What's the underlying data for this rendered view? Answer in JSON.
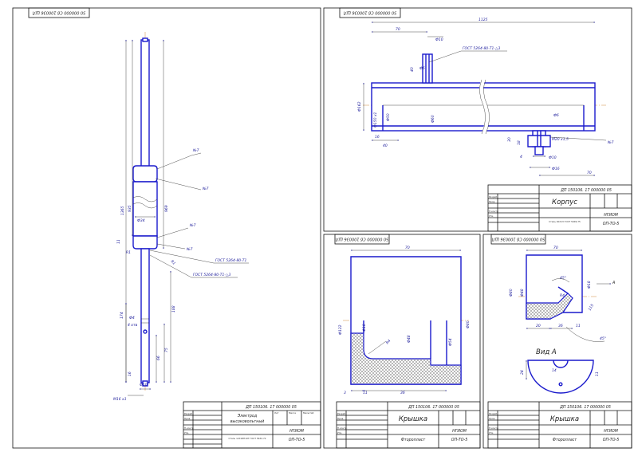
{
  "stamps": {
    "electrode": "50 000000 Сб 100036 ШЛ",
    "housing": "50 000000 Сб 100036 ШЛ",
    "lid": "50 000000 Сб 100036 ШЛ",
    "cap": "50 000000 Сб 100036 ШЛ"
  },
  "electrode": {
    "dims": {
      "total": "1365",
      "upper": "935",
      "mid": "969",
      "d34": "Ф34",
      "d10": "Ф10",
      "d4": "Ф4",
      "d4b": "4 отв",
      "m16": "М16 х1",
      "l11": "11",
      "l174": "174",
      "l188": "188",
      "l75": "75",
      "l66": "66",
      "l16": "16",
      "r1": "R1",
      "r1b": "R1",
      "r1c": "R1"
    },
    "callouts": [
      "№7",
      "№7",
      "№7",
      "№7",
      "№7"
    ],
    "gost1": "ГОСТ 5264-80-Т1",
    "gost2": "ГОСТ 5264-80-Т1-△3",
    "title": {
      "doc": "ДП 150106. 17 000000 05",
      "name1": "Электрод",
      "name2": "высоковольтный",
      "material": "Сталь 12Х18Н10Т ГОСТ 5632-72",
      "org1": "НГИОМ",
      "org2": "ОП-ТО-5"
    }
  },
  "housing": {
    "dims": {
      "w": "1125",
      "l70": "70",
      "d10": "Ф10",
      "d6": "Ф6",
      "l40": "40",
      "d162": "Ф162",
      "d50": "Ф50",
      "d60": "Ф60",
      "d150": "Ф150 х1",
      "l16": "16",
      "l40b": "40",
      "l30": "30",
      "l18": "18",
      "d10b": "Ф10",
      "d16": "Ф16",
      "l70b": "70",
      "d6b": "Ф6",
      "m20": "М20 х1,5",
      "l4": "4"
    },
    "callout": "№7",
    "gost": "ГОСТ 5264-80-Т1-△3",
    "title": {
      "doc": "ДП 150106. 17 000000 05",
      "name": "Корпус",
      "material": "Сталь 40Х13 ГОСТ 5949-75",
      "org1": "НГИОМ",
      "org2": "ОП-ТО-5"
    }
  },
  "lid": {
    "dims": {
      "w": "70",
      "d122": "Ф122",
      "d18": "Ф18",
      "d48": "Ф48",
      "d54": "Ф54",
      "d80": "Ф80",
      "r4": "R4",
      "l3": "3",
      "l11": "11",
      "l36": "36"
    },
    "title": {
      "doc": "ДП 150106. 17 000000 05",
      "name": "Крышка",
      "material": "Фторопласт",
      "org1": "НГИОМ",
      "org2": "ОП-ТО-5"
    }
  },
  "cap": {
    "dims": {
      "w": "70",
      "d80": "Ф80",
      "d48": "Ф48",
      "d18": "Ф18",
      "l45": "45°",
      "l45b": "45°",
      "l20": "20",
      "l36": "36",
      "l11": "11",
      "r4": "R4",
      "l115": "115",
      "l14": "14",
      "l24": "24",
      "l11b": "11"
    },
    "view_arrow": "А",
    "view_label": "Вид А",
    "title": {
      "doc": "ДП 150106. 17 000000 05",
      "name": "Крышка",
      "material": "Фторопласт",
      "org1": "НГИОМ",
      "org2": "ОП-ТО-5"
    }
  },
  "tb_small": {
    "r1": "Изм",
    "r2": "Лист",
    "r3": "№ докум.",
    "r4": "Подп.",
    "r5": "Дата",
    "dev": "Разраб.",
    "chk": "Пров.",
    "tk": "Т.контр.",
    "nk": "Н.контр.",
    "utv": "Утв.",
    "lit": "Лит",
    "mass": "Масса",
    "scale": "Масштаб",
    "sheet": "Лист",
    "sheets": "Листов"
  }
}
